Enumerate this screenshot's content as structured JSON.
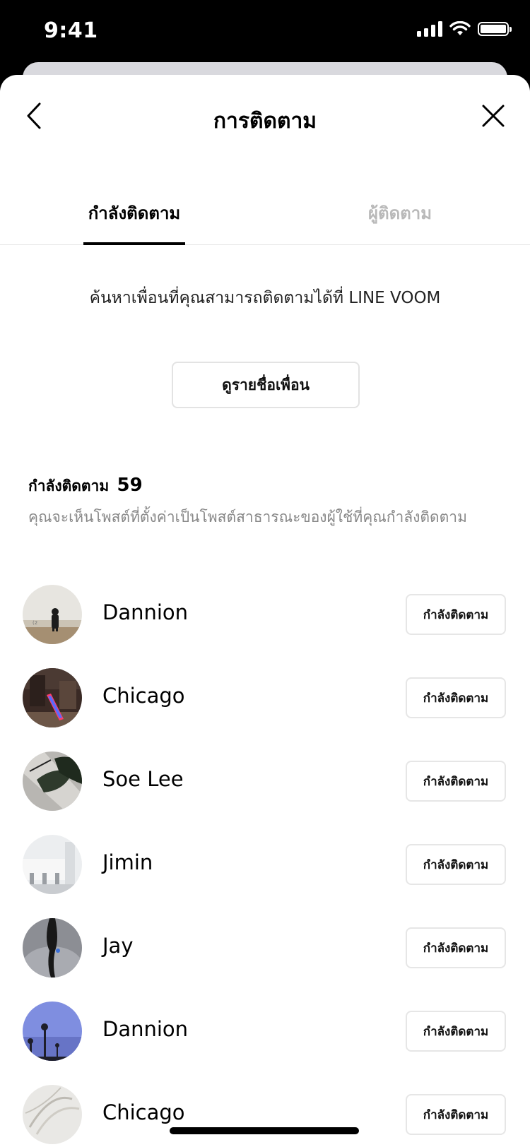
{
  "status_bar": {
    "time": "9:41"
  },
  "header": {
    "title": "การติดตาม"
  },
  "tabs": [
    {
      "label": "กำลังติดตาม",
      "active": true
    },
    {
      "label": "ผู้ติดตาม",
      "active": false
    }
  ],
  "discover": {
    "hint": "ค้นหาเพื่อนที่คุณสามารถติดตามได้ที่ LINE VOOM",
    "button_label": "ดูรายชื่อเพื่อน"
  },
  "following_section": {
    "title": "กำลังติดตาม",
    "count": "59",
    "description": "คุณจะเห็นโพสต์ที่ตั้งค่าเป็นโพสต์สาธารณะของผู้ใช้ที่คุณกำลังติดตาม"
  },
  "users": [
    {
      "name": "Dannion",
      "button": "กำลังติดตาม"
    },
    {
      "name": "Chicago",
      "button": "กำลังติดตาม"
    },
    {
      "name": "Soe Lee",
      "button": "กำลังติดตาม"
    },
    {
      "name": "Jimin",
      "button": "กำลังติดตาม"
    },
    {
      "name": "Jay",
      "button": "กำลังติดตาม"
    },
    {
      "name": "Dannion",
      "button": "กำลังติดตาม"
    },
    {
      "name": "Chicago",
      "button": "กำลังติดตาม"
    }
  ],
  "icons": {
    "back": "chevron-left-icon",
    "close": "close-icon",
    "signal": "cellular-signal-icon",
    "wifi": "wifi-icon",
    "battery": "battery-icon"
  }
}
